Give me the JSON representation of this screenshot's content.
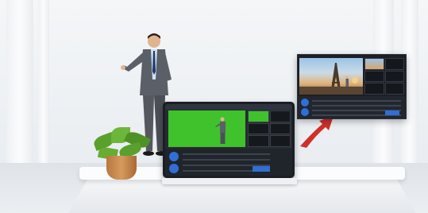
{
  "scene": {
    "description_colors": {
      "chroma_green": "#3fc22b",
      "device_dark": "#1b1e24",
      "arrow_red": "#d0302a",
      "accent_blue": "#2f6fd6"
    },
    "icons": [
      "presenter",
      "potted-plant",
      "video-switcher-device",
      "output-preview-panel",
      "arrow"
    ]
  }
}
